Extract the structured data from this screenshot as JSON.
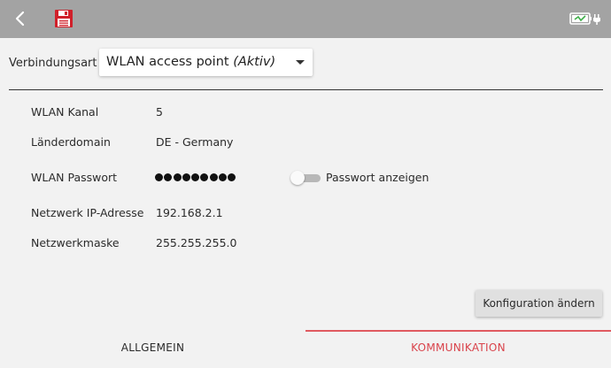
{
  "header": {
    "back_icon": "chevron-left-icon",
    "save_icon": "floppy-disk-icon",
    "battery_icon": "battery-charging-icon",
    "bar_color": "#a3a3a3",
    "save_color": "#d0202a"
  },
  "connection": {
    "label": "Verbindungsart",
    "selected": "WLAN access point",
    "status": "(Aktiv)"
  },
  "fields": {
    "channel": {
      "label": "WLAN Kanal",
      "value": "5"
    },
    "country": {
      "label": "Länderdomain",
      "value": "DE - Germany"
    },
    "password": {
      "label": "WLAN Passwort",
      "masked_length": 9
    },
    "ip": {
      "label": "Netzwerk IP-Adresse",
      "value": "192.168.2.1"
    },
    "mask": {
      "label": "Netzwerkmaske",
      "value": "255.255.255.0"
    }
  },
  "show_password": {
    "label": "Passwort anzeigen",
    "checked": false
  },
  "configure_button": {
    "label": "Konfiguration ändern"
  },
  "tabs": [
    {
      "label": "ALLGEMEIN",
      "active": false
    },
    {
      "label": "KOMMUNIKATION",
      "active": true
    }
  ],
  "accent_color": "#d9434b"
}
